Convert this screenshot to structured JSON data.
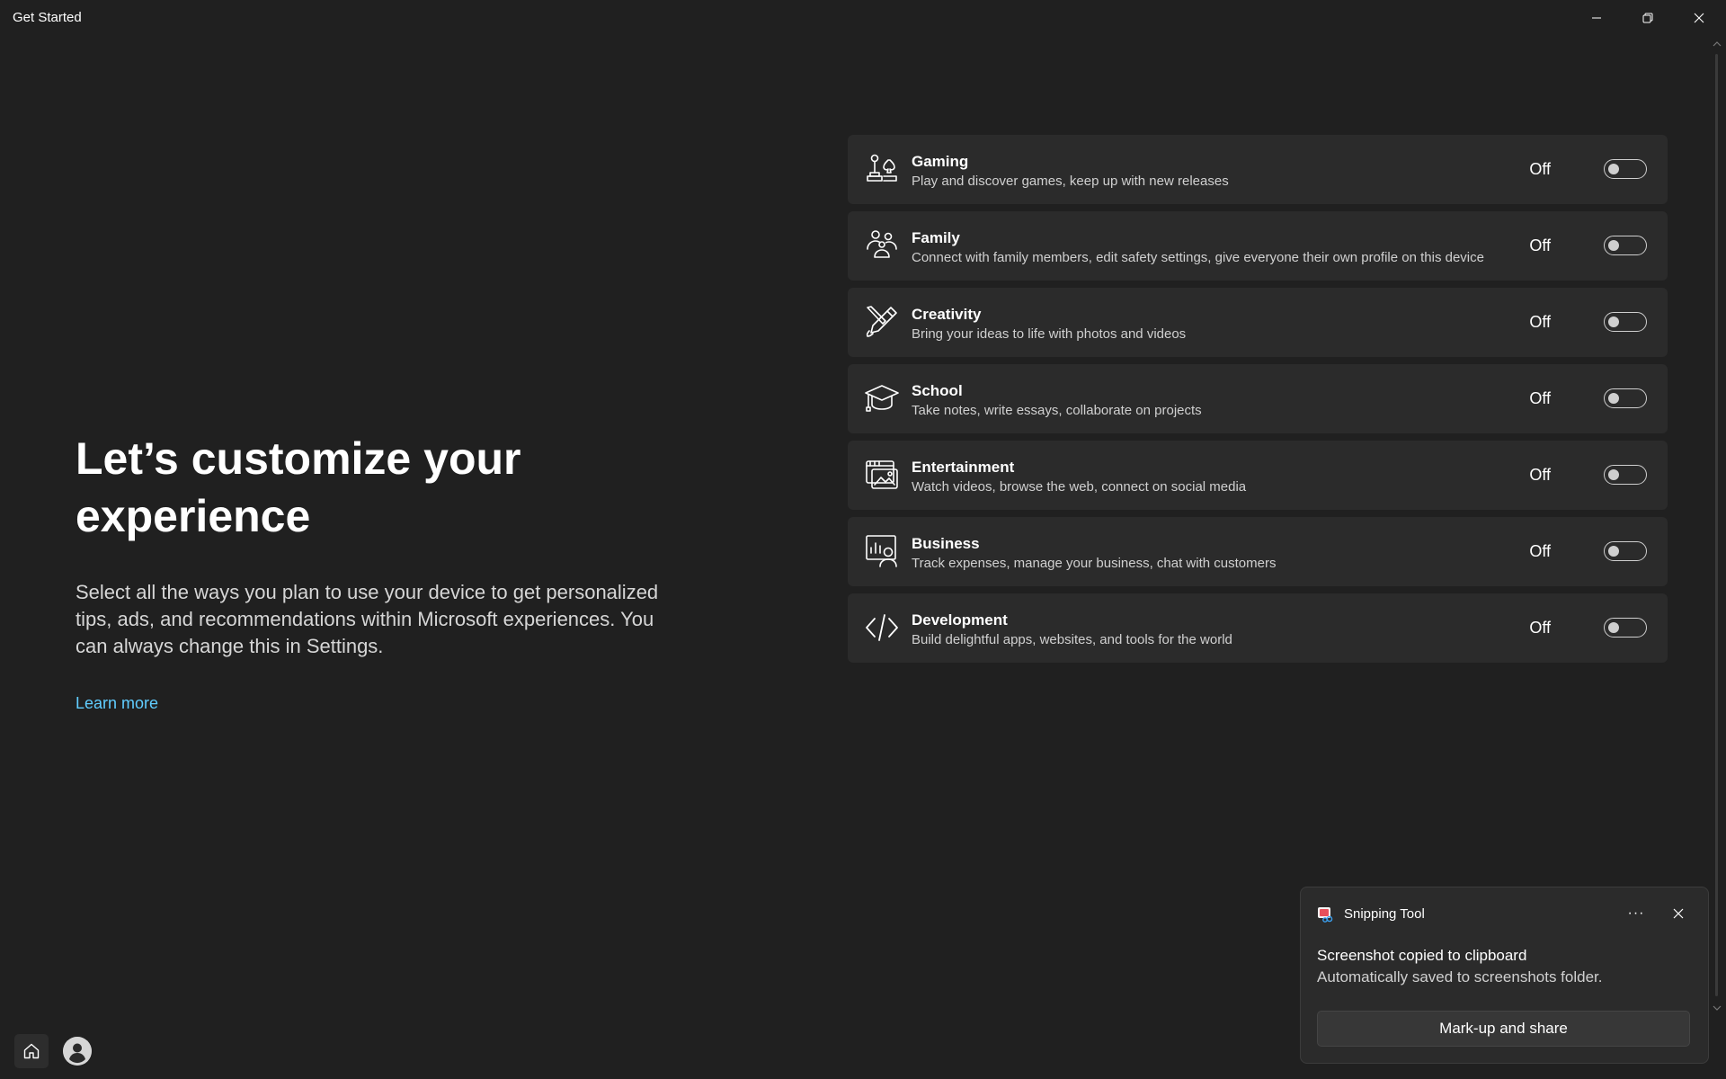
{
  "window": {
    "title": "Get Started"
  },
  "main": {
    "headline": "Let’s customize your experience",
    "description": "Select all the ways you plan to use your device to get personalized tips, ads, and recommendations within Microsoft experiences. You can always change this in Settings.",
    "learn_more": "Learn more"
  },
  "options": [
    {
      "title": "Gaming",
      "description": "Play and discover games, keep up with new releases",
      "state": "Off",
      "icon": "gaming-icon",
      "enabled": false
    },
    {
      "title": "Family",
      "description": "Connect with family members, edit safety settings, give everyone their own profile on this device",
      "state": "Off",
      "icon": "family-icon",
      "enabled": false
    },
    {
      "title": "Creativity",
      "description": "Bring your ideas to life with photos and videos",
      "state": "Off",
      "icon": "creativity-icon",
      "enabled": false
    },
    {
      "title": "School",
      "description": "Take notes, write essays, collaborate on projects",
      "state": "Off",
      "icon": "school-icon",
      "enabled": false
    },
    {
      "title": "Entertainment",
      "description": "Watch videos, browse the web, connect on social media",
      "state": "Off",
      "icon": "entertainment-icon",
      "enabled": false
    },
    {
      "title": "Business",
      "description": "Track expenses, manage your business, chat with customers",
      "state": "Off",
      "icon": "business-icon",
      "enabled": false
    },
    {
      "title": "Development",
      "description": "Build delightful apps, websites, and tools for the world",
      "state": "Off",
      "icon": "development-icon",
      "enabled": false
    }
  ],
  "toast": {
    "app_name": "Snipping Tool",
    "more_label": "···",
    "heading": "Screenshot copied to clipboard",
    "body": "Automatically saved to screenshots folder.",
    "button_label": "Mark-up and share"
  },
  "colors": {
    "background": "#202020",
    "card": "#2b2b2b",
    "link": "#60cdff",
    "text": "#ffffff"
  }
}
